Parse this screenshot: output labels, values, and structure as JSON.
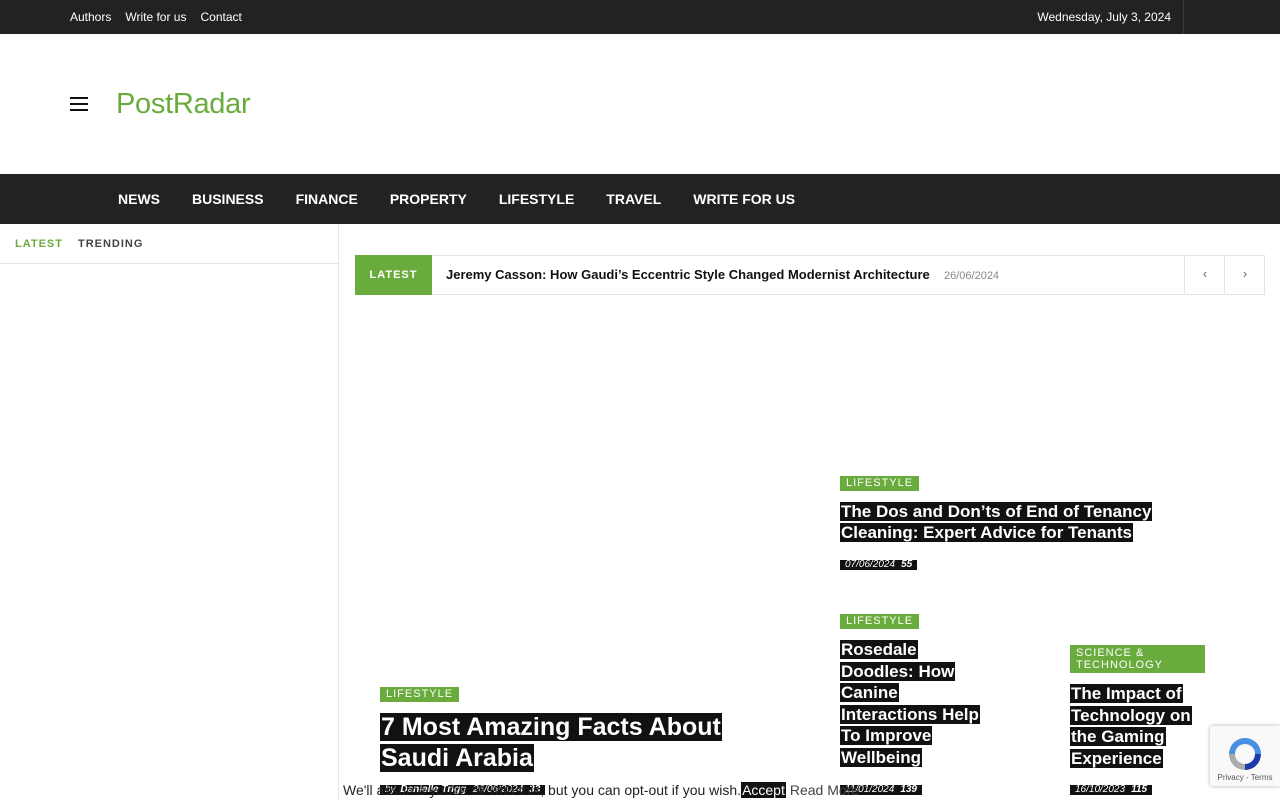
{
  "topbar": {
    "links": [
      "Authors",
      "Write for us",
      "Contact"
    ],
    "date": "Wednesday, July 3, 2024"
  },
  "site": {
    "logo": "PostRadar"
  },
  "nav": [
    "NEWS",
    "BUSINESS",
    "FINANCE",
    "PROPERTY",
    "LIFESTYLE",
    "TRAVEL",
    "WRITE FOR US"
  ],
  "sidebar": {
    "tabs": [
      "LATEST",
      "TRENDING"
    ]
  },
  "ticker": {
    "label": "LATEST",
    "title": "Jeremy Casson: How Gaudi’s Eccentric Style Changed Modernist Architecture",
    "date": "26/06/2024"
  },
  "featured": {
    "main": {
      "category": "LIFESTYLE",
      "title": "7 Most Amazing Facts About Saudi Arabia",
      "author_prefix": "by",
      "author": "Danielle Trigg",
      "date": "26/06/2024",
      "views": "33"
    },
    "top_right": {
      "category": "LIFESTYLE",
      "title": "The Dos and Don’ts of End of Tenancy Cleaning: Expert Advice for Tenants",
      "date": "07/06/2024",
      "views": "55"
    },
    "bottom_middle": {
      "category": "LIFESTYLE",
      "title": "Rosedale Doodles: How Canine Interactions Help To Improve Wellbeing",
      "date": "11/01/2024",
      "views": "139"
    },
    "bottom_right": {
      "category": "SCIENCE & TECHNOLOGY",
      "title": "The Impact of Technology on the Gaming Experience",
      "date": "16/10/2023",
      "views": "115"
    }
  },
  "cookie": {
    "text": "We'll assume you're ok with this, but you can opt-out if you wish.",
    "accept": "Accept",
    "read_more": "Read More"
  },
  "recaptcha": {
    "text": "Privacy - Terms"
  },
  "colors": {
    "accent": "#6aab3e",
    "dark": "#222222"
  }
}
